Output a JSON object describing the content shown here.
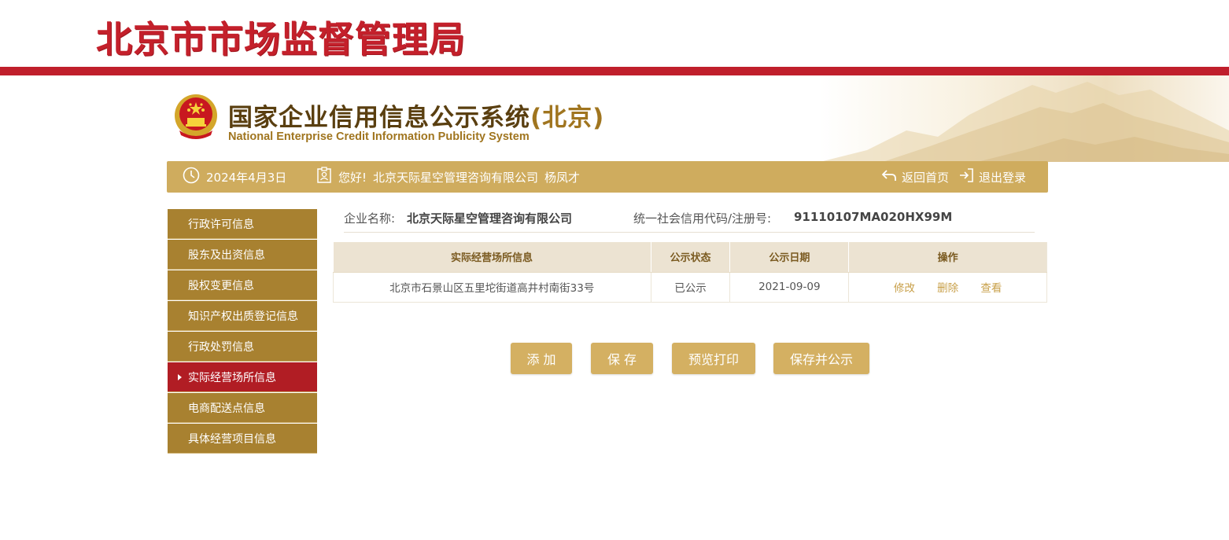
{
  "header": {
    "bureau_title": "北京市市场监督管理局",
    "system_title": "国家企业信用信息公示系统",
    "system_title_region": "(北京)",
    "system_subtitle": "National Enterprise Credit Information Publicity System"
  },
  "info_bar": {
    "date": "2024年4月3日",
    "greeting": "您好!",
    "company": "北京天际星空管理咨询有限公司",
    "user": "杨凤才",
    "home_link": "返回首页",
    "logout_link": "退出登录"
  },
  "sidebar": {
    "items": [
      {
        "label": "行政许可信息",
        "active": false
      },
      {
        "label": "股东及出资信息",
        "active": false
      },
      {
        "label": "股权变更信息",
        "active": false
      },
      {
        "label": "知识产权出质登记信息",
        "active": false
      },
      {
        "label": "行政处罚信息",
        "active": false
      },
      {
        "label": "实际经营场所信息",
        "active": true
      },
      {
        "label": "电商配送点信息",
        "active": false
      },
      {
        "label": "具体经营项目信息",
        "active": false
      }
    ]
  },
  "company_info": {
    "name_label": "企业名称:",
    "name_value": "北京天际星空管理咨询有限公司",
    "code_label": "统一社会信用代码/注册号:",
    "code_value": "91110107MA020HX99M"
  },
  "table": {
    "headers": [
      "实际经营场所信息",
      "公示状态",
      "公示日期",
      "操作"
    ],
    "rows": [
      {
        "address": "北京市石景山区五里坨街道高井村南街33号",
        "status": "已公示",
        "date": "2021-09-09",
        "actions": [
          "修改",
          "删除",
          "查看"
        ]
      }
    ]
  },
  "buttons": {
    "add": "添 加",
    "save": "保 存",
    "preview_print": "预览打印",
    "save_publish": "保存并公示"
  },
  "colors": {
    "brand_red": "#c01f2c",
    "gold": "#cfac5e",
    "sidebar_brown": "#a88130",
    "active_red": "#b11d24"
  }
}
